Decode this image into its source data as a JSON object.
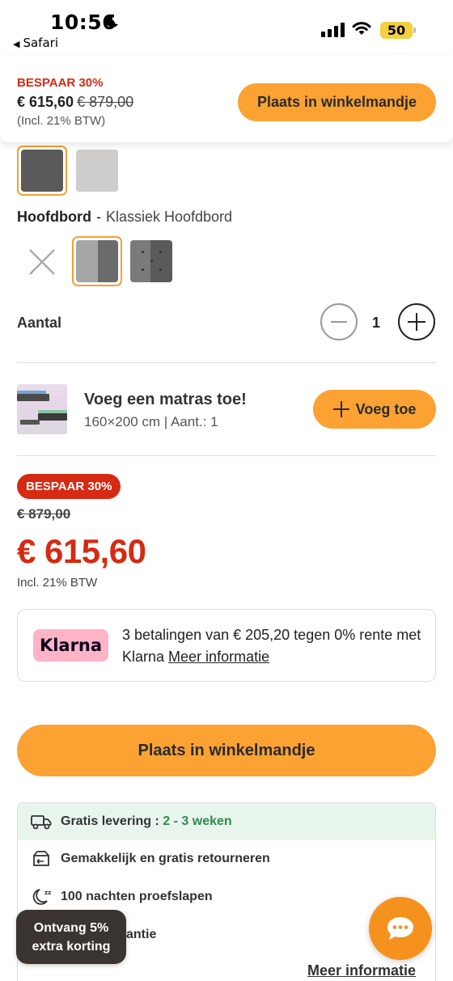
{
  "status_bar": {
    "time": "10:56",
    "back_app": "Safari",
    "battery": "50"
  },
  "sticky_bar": {
    "save_label": "BESPAAR 30%",
    "price": "€ 615,60",
    "old_price": "€ 879,00",
    "vat_note": "(Incl. 21% BTW)",
    "cart_button": "Plaats in winkelmandje"
  },
  "headboard": {
    "label": "Hoofdbord",
    "separator": "-",
    "value": "Klassiek Hoofdbord"
  },
  "quantity": {
    "label": "Aantal",
    "value": "1"
  },
  "mattress_upsell": {
    "title": "Voeg een matras toe!",
    "subtitle": "160×200 cm | Aant.: 1",
    "button": "Voeg toe"
  },
  "price_block": {
    "badge": "BESPAAR 30%",
    "old_price": "€ 879,00",
    "price": "€ 615,60",
    "vat_note": "Incl. 21% BTW"
  },
  "klarna": {
    "logo": "Klarna",
    "text_line": "3 betalingen van € 205,20 tegen 0% rente met Klarna",
    "link": "Meer informatie"
  },
  "main_cart_button": "Plaats in winkelmandje",
  "benefits": {
    "delivery_label": "Gratis levering :",
    "delivery_value": "2 - 3 weken",
    "returns": "Gemakkelijk en gratis retourneren",
    "trial": "100 nachten proefslapen",
    "warranty_partial": "antie",
    "more_info": "Meer informatie"
  },
  "promo": {
    "line1": "Ontvang 5%",
    "line2": "extra korting"
  },
  "colors": {
    "accent_orange": "#fba233",
    "sale_red": "#d62a12",
    "klarna_pink": "#ffb3c7",
    "delivery_green": "#2e8a52"
  }
}
